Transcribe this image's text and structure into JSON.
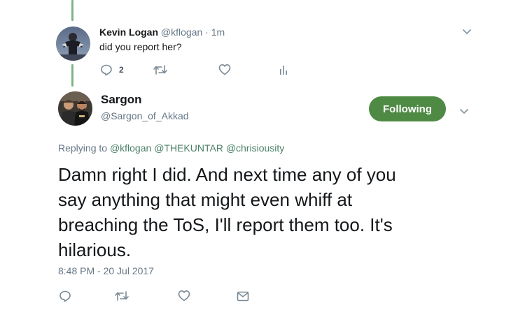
{
  "reply_tweet": {
    "display_name": "Kevin Logan",
    "handle": "@kflogan",
    "separator": "·",
    "time_ago": "1m",
    "text": "did you report her?",
    "reply_count": "2",
    "icons": {
      "reply": "reply-icon",
      "retweet": "retweet-icon",
      "like": "heart-icon",
      "analytics": "analytics-icon",
      "menu": "chevron-down-icon"
    }
  },
  "main_tweet": {
    "display_name": "Sargon",
    "handle": "@Sargon_of_Akkad",
    "follow_label": "Following",
    "replying_prefix": "Replying to",
    "replying_to": [
      "@kflogan",
      "@THEKUNTAR",
      "@chrisiousity"
    ],
    "text_lines": [
      "Damn right I did. And next time any of you",
      "say anything that might even whiff at",
      "breaching the ToS, I'll report them too. It's",
      "hilarious."
    ],
    "timestamp": "8:48 PM - 20 Jul 2017",
    "icons": {
      "reply": "reply-icon",
      "retweet": "retweet-icon",
      "like": "heart-icon",
      "dm": "envelope-icon",
      "menu": "chevron-down-icon"
    }
  },
  "colors": {
    "thread_line": "#7fb584",
    "follow_button": "#4f8a45",
    "link": "#4a7f68",
    "muted_text": "#657786"
  }
}
